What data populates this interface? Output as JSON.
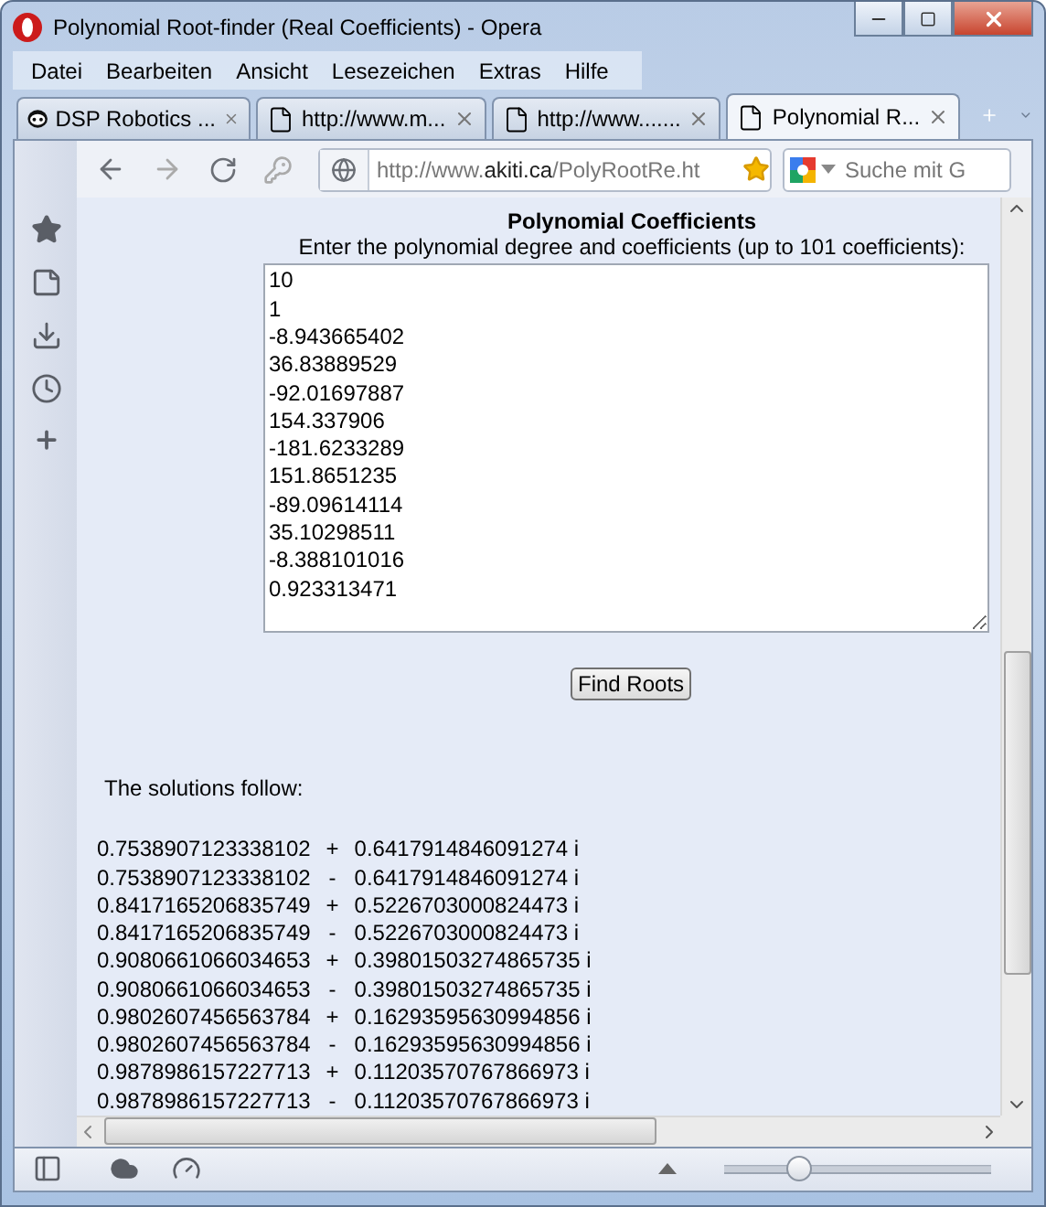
{
  "window": {
    "title": "Polynomial Root-finder (Real Coefficients) - Opera"
  },
  "menu": [
    "Datei",
    "Bearbeiten",
    "Ansicht",
    "Lesezeichen",
    "Extras",
    "Hilfe"
  ],
  "tabs": [
    {
      "label": "DSP Robotics ...",
      "kind": "robot",
      "selected": false
    },
    {
      "label": "http://www.m...",
      "kind": "page",
      "selected": false
    },
    {
      "label": "http://www.......",
      "kind": "page",
      "selected": false
    },
    {
      "label": "Polynomial R...",
      "kind": "page",
      "selected": true
    }
  ],
  "address": {
    "prefix": "http://www.",
    "domain": "akiti.ca",
    "path": "/PolyRootRe.ht"
  },
  "search": {
    "placeholder": "Suche mit G"
  },
  "page": {
    "heading": "Polynomial Coefficients",
    "instruction": "Enter the polynomial degree and coefficients (up to 101 coefficients):",
    "coefficients": [
      "10",
      "1",
      "-8.943665402",
      "36.83889529",
      "-92.01697887",
      "154.337906",
      "-181.6233289",
      "151.8651235",
      "-89.09614114",
      "35.10298511",
      "-8.388101016",
      "0.923313471"
    ],
    "button": "Find Roots",
    "solutions_label": "The solutions follow:",
    "solutions": [
      {
        "real": "0.7538907123338102",
        "sign": "+",
        "imag": "0.6417914846091274 i"
      },
      {
        "real": "0.7538907123338102",
        "sign": "-",
        "imag": "0.6417914846091274 i"
      },
      {
        "real": "0.8417165206835749",
        "sign": "+",
        "imag": "0.5226703000824473 i"
      },
      {
        "real": "0.8417165206835749",
        "sign": "-",
        "imag": "0.5226703000824473 i"
      },
      {
        "real": "0.9080661066034653",
        "sign": "+",
        "imag": "0.39801503274865735 i"
      },
      {
        "real": "0.9080661066034653",
        "sign": "-",
        "imag": "0.39801503274865735 i"
      },
      {
        "real": "0.9802607456563784",
        "sign": "+",
        "imag": "0.16293595630994856 i"
      },
      {
        "real": "0.9802607456563784",
        "sign": "-",
        "imag": "0.16293595630994856 i"
      },
      {
        "real": "0.9878986157227713",
        "sign": "+",
        "imag": "0.11203570767866973 i"
      },
      {
        "real": "0.9878986157227713",
        "sign": "-",
        "imag": "0.11203570767866973 i"
      }
    ]
  },
  "zoom": {
    "level": 0.28
  }
}
